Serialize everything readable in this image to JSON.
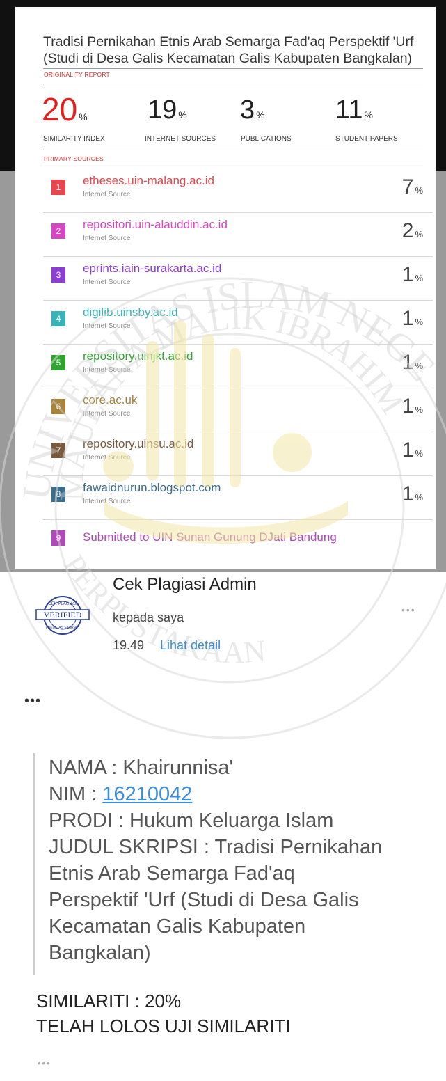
{
  "report": {
    "title_lines": [
      "Tradisi Pernikahan Etnis Arab Semarga Fad'aq Perspektif 'Urf",
      "(Studi di Desa Galis Kecamatan Galis Kabupaten Bangkalan)"
    ],
    "originality_label": "ORIGINALITY REPORT",
    "primary_sources_label": "PRIMARY SOURCES",
    "pct_symbol": "%",
    "metrics": [
      {
        "value": "20",
        "label": "SIMILARITY INDEX"
      },
      {
        "value": "19",
        "label": "INTERNET SOURCES"
      },
      {
        "value": "3",
        "label": "PUBLICATIONS"
      },
      {
        "value": "11",
        "label": "STUDENT PAPERS"
      }
    ],
    "sources": [
      {
        "num": "1",
        "name": "etheses.uin-malang.ac.id",
        "type": "Internet Source",
        "pct": "7",
        "color": "#e8474d"
      },
      {
        "num": "2",
        "name": "repositori.uin-alauddin.ac.id",
        "type": "Internet Source",
        "pct": "2",
        "color": "#d647c4"
      },
      {
        "num": "3",
        "name": "eprints.iain-surakarta.ac.id",
        "type": "Internet Source",
        "pct": "1",
        "color": "#8b3fd1"
      },
      {
        "num": "4",
        "name": "digilib.uinsby.ac.id",
        "type": "Internet Source",
        "pct": "1",
        "color": "#3ab3b8"
      },
      {
        "num": "5",
        "name": "repository.uinjkt.ac.id",
        "type": "Internet Source",
        "pct": "1",
        "color": "#2ea52e"
      },
      {
        "num": "6",
        "name": "core.ac.uk",
        "type": "Internet Source",
        "pct": "1",
        "color": "#a8833a"
      },
      {
        "num": "7",
        "name": "repository.uinsu.ac.id",
        "type": "Internet Source",
        "pct": "1",
        "color": "#7a5a3c"
      },
      {
        "num": "8",
        "name": "fawaidnurun.blogspot.com",
        "type": "Internet Source",
        "pct": "1",
        "color": "#3b6c8a"
      },
      {
        "num": "9",
        "name": "Submitted to UIN Sunan Gunung DJati Bandung",
        "type": "",
        "pct": "",
        "color": "#b04ab8"
      }
    ]
  },
  "watermark": {
    "line1": "UNIVERSITAS ISLAM NEGERI",
    "line2": "MAULANA MALIK IBRAHIM",
    "line3": "PERPUSTAKAAN"
  },
  "email": {
    "avatar_badge": "VERIFIED",
    "avatar_top_text": "CEK PLAGIASI",
    "avatar_bottom_text": "FAKULTAS SYARIAH",
    "sender": "Cek Plagiasi Admin",
    "recipient": "kepada saya",
    "time": "19.49",
    "detail_link": "Lihat detail",
    "menu_icon": "•••",
    "expand_icon": "•••",
    "body": {
      "nama": "NAMA : Khairunnisa'",
      "nim_label": "NIM : ",
      "nim_value": "16210042",
      "prodi": "PRODI : Hukum Keluarga Islam",
      "judul_lines": [
        "JUDUL SKRIPSI : Tradisi Pernikahan",
        "Etnis Arab Semarga Fad'aq",
        "Perspektif 'Urf (Studi di Desa Galis",
        "Kecamatan Galis Kabupaten",
        "Bangkalan)"
      ]
    },
    "result_lines": [
      "SIMILARITI : 20%",
      "TELAH LOLOS UJI SIMILARITI"
    ],
    "bottom_icon": "•••"
  }
}
